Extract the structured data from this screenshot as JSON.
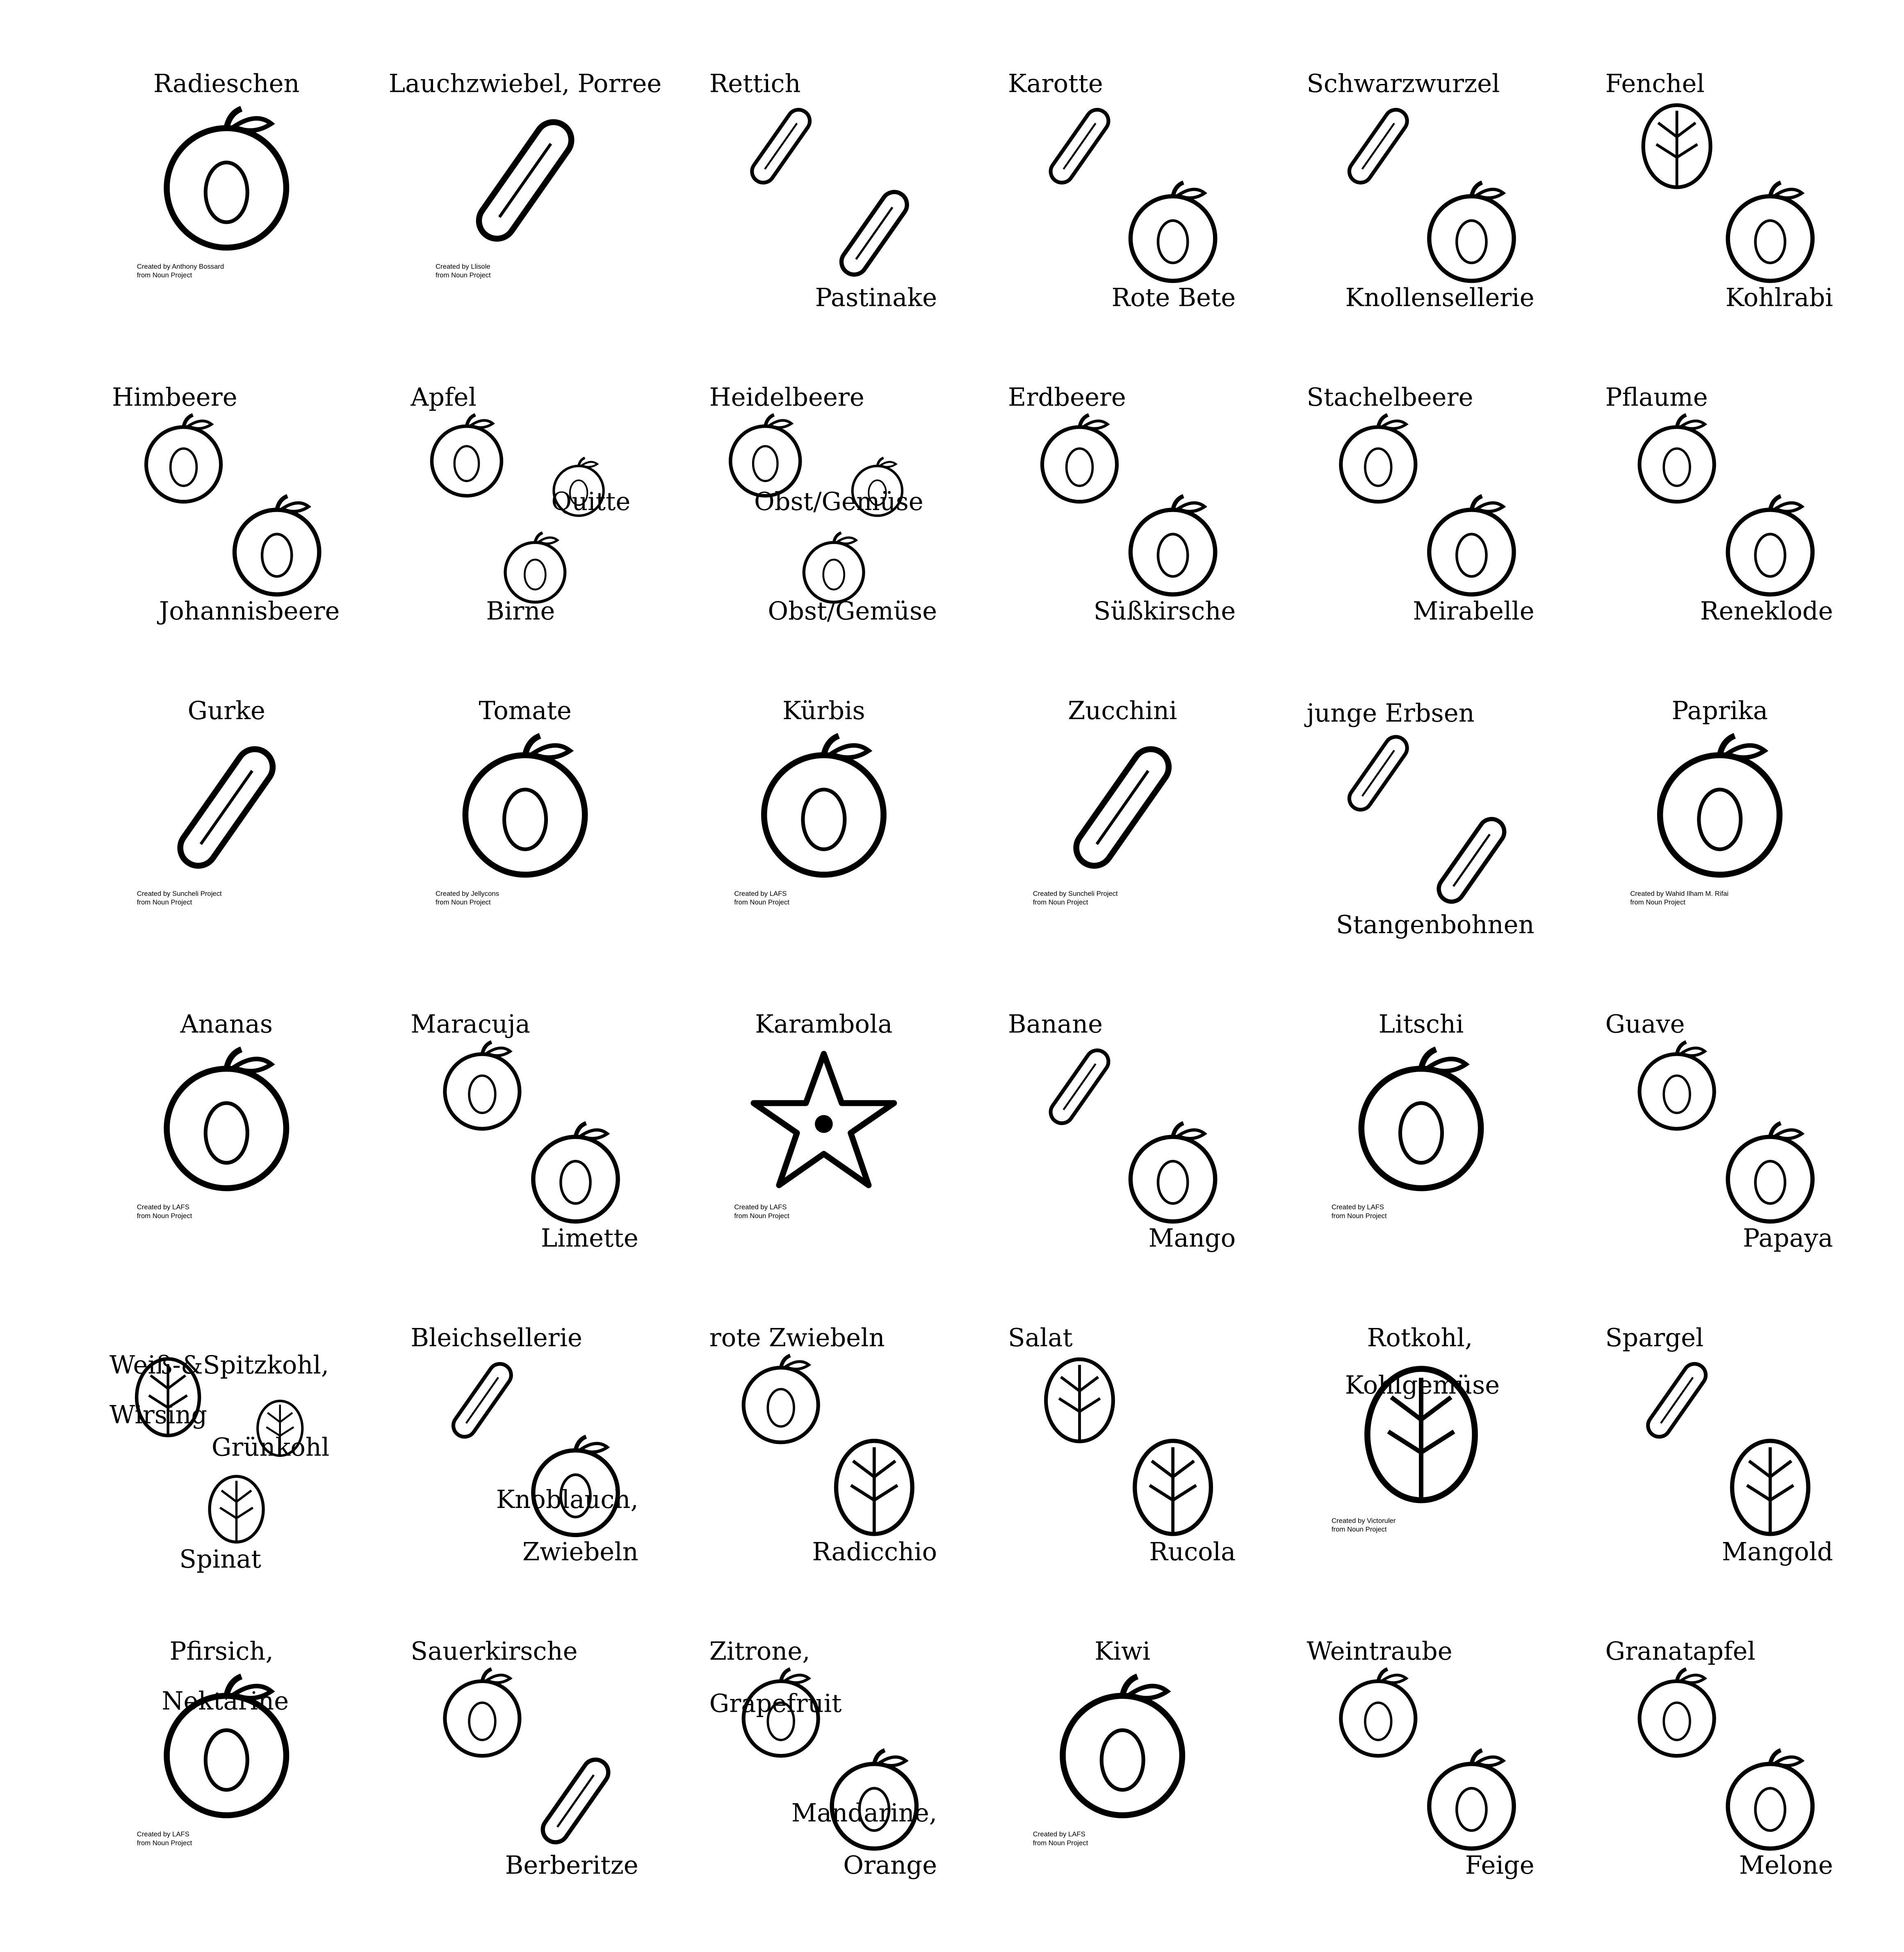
{
  "colors": {
    "ink": "#000000",
    "background": "#ffffff"
  },
  "cells": [
    {
      "labels": [
        "Radieschen"
      ],
      "icons": [
        "radish"
      ],
      "credit": [
        "Created by Anthony Bossard",
        "from Noun Project"
      ]
    },
    {
      "labels": [
        "Lauchzwiebel, Porree"
      ],
      "icons": [
        "leek"
      ],
      "credit": [
        "Created by Llisole",
        "from Noun Project"
      ]
    },
    {
      "labels": [
        "Rettich",
        "Pastinake"
      ],
      "icons": [
        "white-radish",
        "parsnip"
      ]
    },
    {
      "labels": [
        "Karotte",
        "Rote Bete"
      ],
      "icons": [
        "carrot",
        "beetroot"
      ]
    },
    {
      "labels": [
        "Schwarzwurzel",
        "Knollensellerie"
      ],
      "icons": [
        "salsify",
        "celeriac"
      ]
    },
    {
      "labels": [
        "Fenchel",
        "Kohlrabi"
      ],
      "icons": [
        "fennel",
        "kohlrabi"
      ]
    },
    {
      "labels": [
        "Himbeere",
        "Johannisbeere"
      ],
      "icons": [
        "raspberry",
        "currant"
      ]
    },
    {
      "labels": [
        "Apfel",
        "Quitte",
        "Birne"
      ],
      "icons": [
        "apple",
        "quince",
        "pear"
      ]
    },
    {
      "labels": [
        "Heidelbeere",
        "Obst/Gemüse",
        "Obst/Gemüse"
      ],
      "icons": [
        "blueberry",
        "grape-bunch",
        "blackberry"
      ]
    },
    {
      "labels": [
        "Erdbeere",
        "Süßkirsche"
      ],
      "icons": [
        "strawberry",
        "cherry"
      ]
    },
    {
      "labels": [
        "Stachelbeere",
        "Mirabelle"
      ],
      "icons": [
        "gooseberry",
        "mirabelle"
      ]
    },
    {
      "labels": [
        "Pflaume",
        "Reneklode"
      ],
      "icons": [
        "plum",
        "greengage"
      ]
    },
    {
      "labels": [
        "Gurke"
      ],
      "icons": [
        "cucumber"
      ],
      "credit": [
        "Created by Suncheli Project",
        "from Noun Project"
      ]
    },
    {
      "labels": [
        "Tomate"
      ],
      "icons": [
        "tomato"
      ],
      "credit": [
        "Created by Jellycons",
        "from Noun Project"
      ]
    },
    {
      "labels": [
        "Kürbis"
      ],
      "icons": [
        "pumpkin"
      ],
      "credit": [
        "Created by LAFS",
        "from Noun Project"
      ]
    },
    {
      "labels": [
        "Zucchini"
      ],
      "icons": [
        "zucchini"
      ],
      "credit": [
        "Created by Suncheli Project",
        "from Noun Project"
      ]
    },
    {
      "labels": [
        "junge Erbsen",
        "Stangenbohnen"
      ],
      "icons": [
        "pea-pod",
        "green-beans"
      ]
    },
    {
      "labels": [
        "Paprika"
      ],
      "icons": [
        "bell-pepper"
      ],
      "credit": [
        "Created by Wahid Ilham M. Rifai",
        "from Noun Project"
      ]
    },
    {
      "labels": [
        "Ananas"
      ],
      "icons": [
        "pineapple"
      ],
      "credit": [
        "Created by LAFS",
        "from Noun Project"
      ]
    },
    {
      "labels": [
        "Maracuja",
        "Limette"
      ],
      "icons": [
        "passion-fruit",
        "lime"
      ]
    },
    {
      "labels": [
        "Karambola"
      ],
      "icons": [
        "star-fruit"
      ],
      "credit": [
        "Created by LAFS",
        "from Noun Project"
      ]
    },
    {
      "labels": [
        "Banane",
        "Mango"
      ],
      "icons": [
        "banana",
        "mango"
      ]
    },
    {
      "labels": [
        "Litschi"
      ],
      "icons": [
        "lychee"
      ],
      "credit": [
        "Created by LAFS",
        "from Noun Project"
      ]
    },
    {
      "labels": [
        "Guave",
        "Papaya"
      ],
      "icons": [
        "guava",
        "papaya"
      ]
    },
    {
      "labels": [
        "Weiß-&Spitzkohl,",
        "Wirsing",
        "Grünkohl",
        "Spinat"
      ],
      "icons": [
        "cabbage",
        "kale",
        "spinach"
      ]
    },
    {
      "labels": [
        "Bleichsellerie",
        "Knoblauch,",
        "Zwiebeln"
      ],
      "icons": [
        "celery",
        "garlic"
      ]
    },
    {
      "labels": [
        "rote Zwiebeln",
        "Radicchio"
      ],
      "icons": [
        "red-onion",
        "radicchio"
      ]
    },
    {
      "labels": [
        "Salat",
        "Rucola"
      ],
      "icons": [
        "lettuce",
        "rucola"
      ]
    },
    {
      "labels": [
        "Rotkohl,",
        "Kohlgemüse"
      ],
      "icons": [
        "red-cabbage"
      ],
      "credit": [
        "Created by Victoruler",
        "from Noun Project"
      ]
    },
    {
      "labels": [
        "Spargel",
        "Mangold"
      ],
      "icons": [
        "asparagus",
        "chard"
      ]
    },
    {
      "labels": [
        "Pfirsich,",
        "Nektarine"
      ],
      "icons": [
        "peach"
      ],
      "credit": [
        "Created by LAFS",
        "from Noun Project"
      ]
    },
    {
      "labels": [
        "Sauerkirsche",
        "Berberitze"
      ],
      "icons": [
        "sour-cherry",
        "barberry"
      ]
    },
    {
      "labels": [
        "Zitrone,",
        "Grapefruit",
        "Mandarine,",
        "Orange"
      ],
      "icons": [
        "grapefruit",
        "orange"
      ]
    },
    {
      "labels": [
        "Kiwi"
      ],
      "icons": [
        "kiwi"
      ],
      "credit": [
        "Created by LAFS",
        "from Noun Project"
      ]
    },
    {
      "labels": [
        "Weintraube",
        "Feige"
      ],
      "icons": [
        "grapes",
        "fig"
      ]
    },
    {
      "labels": [
        "Granatapfel",
        "Melone"
      ],
      "icons": [
        "pomegranate",
        "melon"
      ]
    }
  ]
}
